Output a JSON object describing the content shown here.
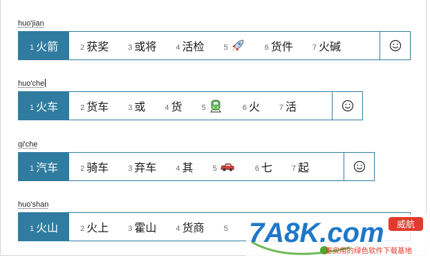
{
  "rows": [
    {
      "pinyin": "huo'jian",
      "candidates": [
        {
          "num": "1",
          "text": "火箭"
        },
        {
          "num": "2",
          "text": "获奖"
        },
        {
          "num": "3",
          "text": "或将"
        },
        {
          "num": "4",
          "text": "活检"
        },
        {
          "num": "5",
          "icon": "rocket-emoji-icon"
        },
        {
          "num": "6",
          "text": "货件"
        },
        {
          "num": "7",
          "text": "火碱"
        }
      ]
    },
    {
      "pinyin": "huo'che",
      "candidates": [
        {
          "num": "1",
          "text": "火车"
        },
        {
          "num": "2",
          "text": "货车"
        },
        {
          "num": "3",
          "text": "或"
        },
        {
          "num": "4",
          "text": "货"
        },
        {
          "num": "5",
          "icon": "train-emoji-icon"
        },
        {
          "num": "6",
          "text": "火"
        },
        {
          "num": "7",
          "text": "活"
        }
      ]
    },
    {
      "pinyin": "qi'che",
      "candidates": [
        {
          "num": "1",
          "text": "汽车"
        },
        {
          "num": "2",
          "text": "骑车"
        },
        {
          "num": "3",
          "text": "弃车"
        },
        {
          "num": "4",
          "text": "其"
        },
        {
          "num": "5",
          "icon": "car-emoji-icon"
        },
        {
          "num": "6",
          "text": "七"
        },
        {
          "num": "7",
          "text": "起"
        }
      ]
    },
    {
      "pinyin": "huo'shan",
      "candidates": [
        {
          "num": "1",
          "text": "火山"
        },
        {
          "num": "2",
          "text": "火上"
        },
        {
          "num": "3",
          "text": "霍山"
        },
        {
          "num": "4",
          "text": "货商"
        },
        {
          "num": "5",
          "text": ""
        }
      ]
    }
  ],
  "watermark": {
    "logo_text": "7A8K.com",
    "badge_text": "威航",
    "tagline": "更实用的绿色软件下载基地"
  },
  "colors": {
    "accent": "#2f7ca0",
    "watermark_blue": "#1e78c8",
    "watermark_red": "#e23a2c",
    "watermark_green": "#4aa82c"
  }
}
